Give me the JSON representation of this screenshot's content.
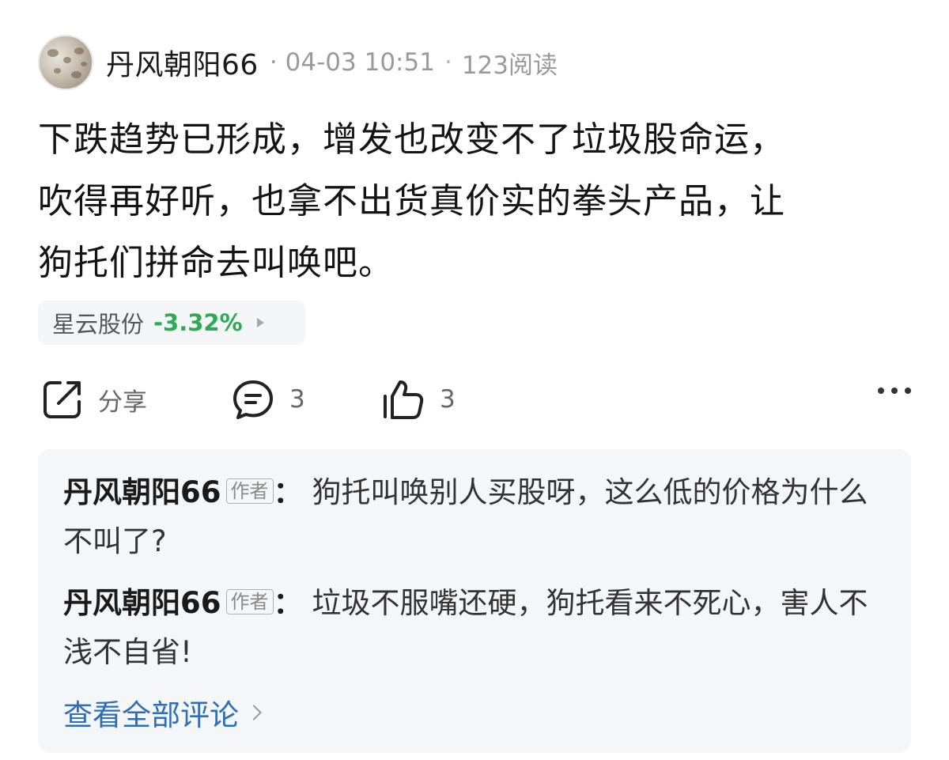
{
  "post": {
    "author": "丹风朝阳66",
    "sep1": "·",
    "time": "04-03 10:51",
    "sep2": "·",
    "reads": "123阅读",
    "body_lines": [
      "下跌趋势已形成，增发也改变不了垃圾股命运，",
      "吹得再好听，也拿不出货真价实的拳头产品，让",
      "狗托们拼命去叫唤吧。"
    ]
  },
  "stock": {
    "name": "星云股份",
    "change": "-3.32%",
    "change_color": "#2eaa54"
  },
  "actions": {
    "share_label": "分享",
    "comment_count": "3",
    "like_count": "3"
  },
  "comments": {
    "items": [
      {
        "author": "丹风朝阳66",
        "badge": "作者",
        "colon": "：",
        "text": "狗托叫唤别人买股呀，这么低的价格为什么不叫了?"
      },
      {
        "author": "丹风朝阳66",
        "badge": "作者",
        "colon": "：",
        "text": "垃圾不服嘴还硬，狗托看来不死心，害人不浅不自省!"
      }
    ],
    "view_all": "查看全部评论"
  },
  "colors": {
    "link": "#2f6db6",
    "stock_down": "#2eaa54"
  }
}
